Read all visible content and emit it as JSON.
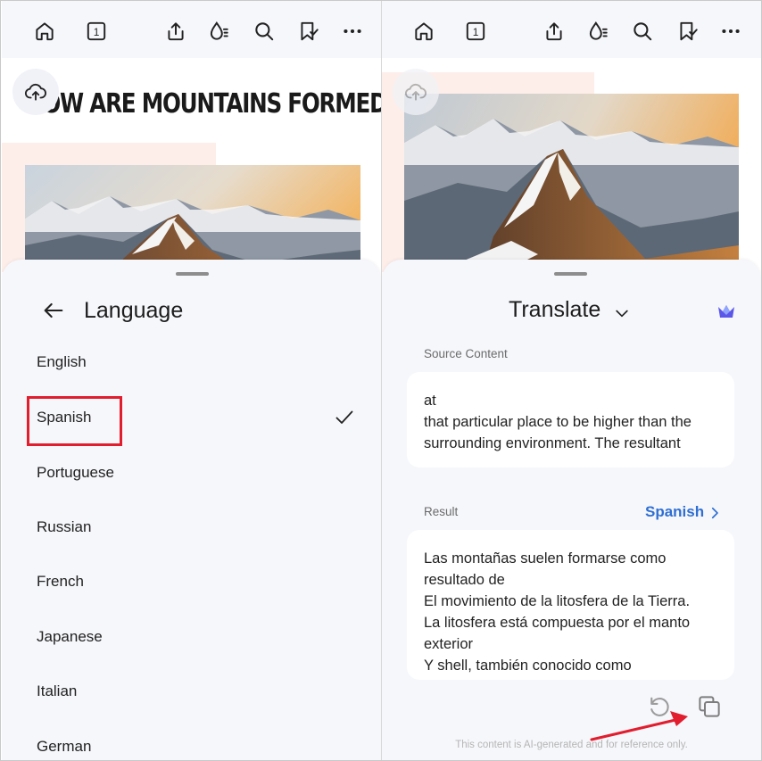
{
  "left": {
    "doc_title": "HOW ARE MOUNTAINS FORMED?",
    "language_sheet": {
      "title": "Language",
      "items": [
        {
          "label": "English",
          "selected": false
        },
        {
          "label": "Spanish",
          "selected": true
        },
        {
          "label": "Portuguese",
          "selected": false
        },
        {
          "label": "Russian",
          "selected": false
        },
        {
          "label": "French",
          "selected": false
        },
        {
          "label": "Japanese",
          "selected": false
        },
        {
          "label": "Italian",
          "selected": false
        },
        {
          "label": "German",
          "selected": false
        }
      ]
    }
  },
  "right": {
    "translate_sheet": {
      "title": "Translate",
      "source_label": "Source Content",
      "source_lines": [
        "at",
        "that particular place to be higher than the",
        "surrounding environment. The resultant"
      ],
      "result_label": "Result",
      "result_language": "Spanish",
      "result_lines": [
        "Las montañas suelen formarse como",
        "resultado de",
        "El movimiento de la litosfera de la Tierra.",
        "La litosfera está compuesta por el manto",
        "exterior",
        "Y shell, también conocido como"
      ],
      "disclaimer": "This content is AI-generated and for reference only."
    }
  },
  "toolbar_icons": [
    "home-icon",
    "page-number-icon",
    "share-icon",
    "ink-icon",
    "search-icon",
    "bookmark-icon",
    "more-icon"
  ],
  "toolbar_page_number": "1",
  "colors": {
    "accent_blue": "#2f6fd3",
    "highlight_red": "#e11d2e",
    "sheet_bg": "#f6f7fb"
  }
}
